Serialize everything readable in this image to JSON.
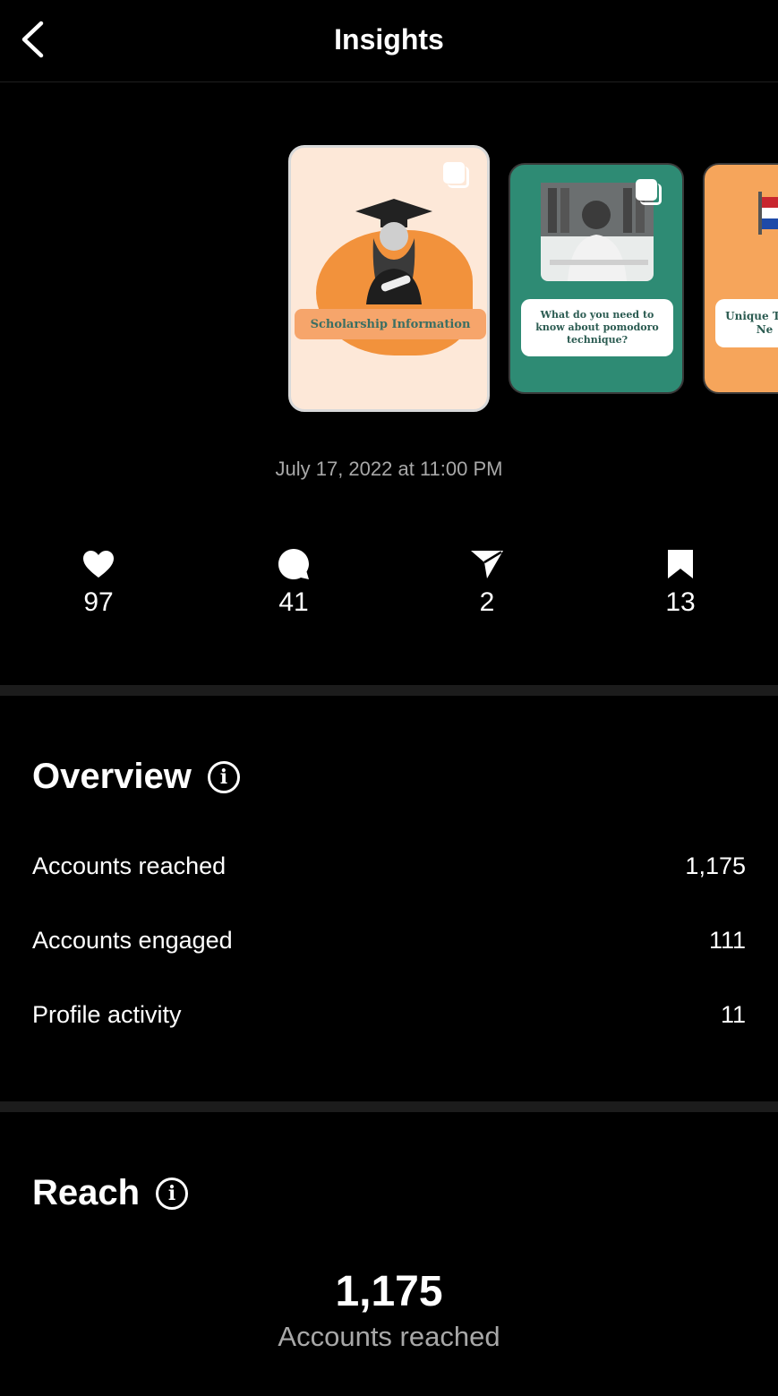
{
  "header": {
    "title": "Insights",
    "back_icon": "chevron-left-icon"
  },
  "carousel": {
    "items": [
      {
        "caption": "Scholarship Information",
        "icon": "multiple-posts-icon"
      },
      {
        "caption": "What do you need to know about pomodoro technique?",
        "icon": "multiple-posts-icon"
      },
      {
        "caption": "Unique T the Ne"
      }
    ]
  },
  "post": {
    "date": "July 17, 2022 at 11:00 PM"
  },
  "stats": {
    "likes": {
      "icon": "heart-icon",
      "value": "97"
    },
    "comments": {
      "icon": "comment-bubble-icon",
      "value": "41"
    },
    "shares": {
      "icon": "send-icon",
      "value": "2"
    },
    "saves": {
      "icon": "bookmark-icon",
      "value": "13"
    }
  },
  "overview": {
    "title": "Overview",
    "info_icon": "i",
    "rows": [
      {
        "label": "Accounts reached",
        "value": "1,175"
      },
      {
        "label": "Accounts engaged",
        "value": "111"
      },
      {
        "label": "Profile activity",
        "value": "11"
      }
    ]
  },
  "reach": {
    "title": "Reach",
    "info_icon": "i",
    "value": "1,175",
    "label": "Accounts reached"
  },
  "colors": {
    "background": "#000000",
    "text": "#ffffff",
    "muted": "#a8a8a8",
    "divider": "#1c1c1c"
  }
}
